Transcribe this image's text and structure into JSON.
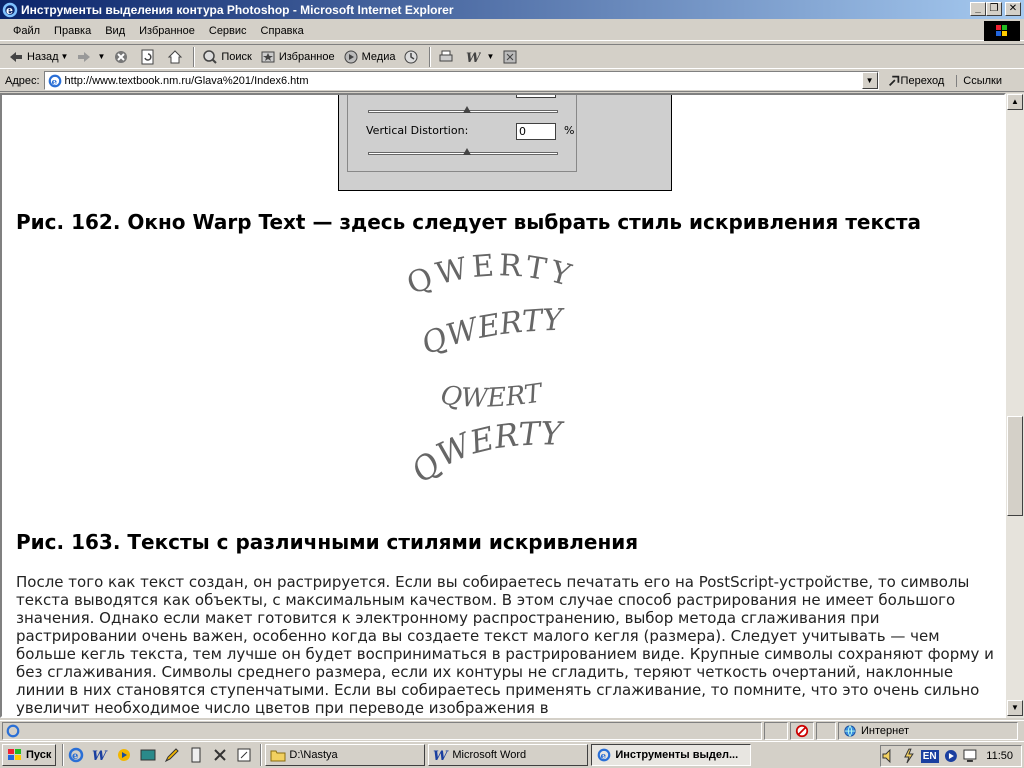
{
  "window": {
    "title": "Инструменты выделения контура Photoshop - Microsoft Internet Explorer"
  },
  "menu": [
    "Файл",
    "Правка",
    "Вид",
    "Избранное",
    "Сервис",
    "Справка"
  ],
  "toolbar": {
    "back": "Назад",
    "search": "Поиск",
    "favorites": "Избранное",
    "media": "Медиа"
  },
  "address": {
    "label": "Адрес:",
    "url": "http://www.textbook.nm.ru/Glava%201/Index6.htm",
    "go": "Переход",
    "links": "Ссылки"
  },
  "dialog": {
    "vertical_label": "Vertical Distortion:",
    "vertical_value": "0",
    "percent": "%"
  },
  "content": {
    "fig162": "Рис. 162. Окно Warp Text — здесь следует выбрать стиль искривления текста",
    "sample_text": "QWERTY",
    "fig163": "Рис. 163. Тексты с различными стилями искривления",
    "paragraph": "После того как текст создан, он растрируется. Если вы собираетесь печатать его на PostScript-устройстве, то символы текста выводятся как объекты, с максимальным качеством. В этом случае способ растрирования не имеет большого значения. Однако если макет готовится к электронному распространению, выбор метода сглаживания при растрировании очень важен, особенно когда вы создаете текст малого кегля (размера). Следует учитывать — чем больше кегль текста, тем лучше он будет восприниматься в растрированием виде. Крупные символы сохраняют форму и без сглаживания. Символы среднего размера, если их контуры не сгладить, теряют четкость очертаний, наклонные линии в них становятся ступенчатыми. Если вы собираетесь применять сглаживание, то помните, что это очень сильно увеличит необходимое число цветов при переводе изображения в"
  },
  "status": {
    "zone": "Интернет"
  },
  "taskbar": {
    "start": "Пуск",
    "tasks": [
      "D:\\Nastya",
      "Microsoft Word",
      "Инструменты выдел..."
    ],
    "lang": "EN",
    "clock": "11:50"
  }
}
